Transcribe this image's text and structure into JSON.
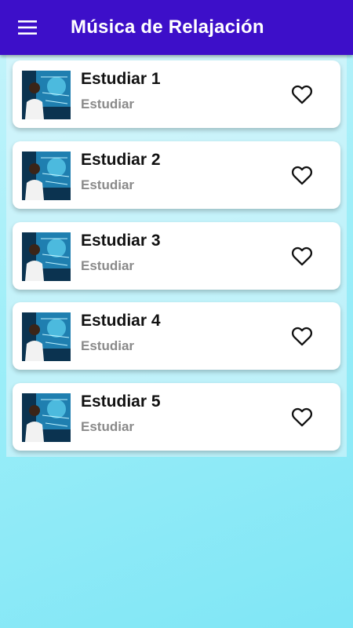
{
  "appbar": {
    "title": "Música de Relajación",
    "menu_icon": "menu-icon"
  },
  "tracks": [
    {
      "title": "Estudiar 1",
      "category": "Estudiar",
      "favorite_icon": "heart-outline-icon"
    },
    {
      "title": "Estudiar 2",
      "category": "Estudiar",
      "favorite_icon": "heart-outline-icon"
    },
    {
      "title": "Estudiar 3",
      "category": "Estudiar",
      "favorite_icon": "heart-outline-icon"
    },
    {
      "title": "Estudiar 4",
      "category": "Estudiar",
      "favorite_icon": "heart-outline-icon"
    },
    {
      "title": "Estudiar 5",
      "category": "Estudiar",
      "favorite_icon": "heart-outline-icon"
    }
  ],
  "colors": {
    "appbar": "#3d0fc9",
    "background": "#9deef8",
    "title_text": "#111111",
    "subtitle_text": "#8a8a8a"
  }
}
